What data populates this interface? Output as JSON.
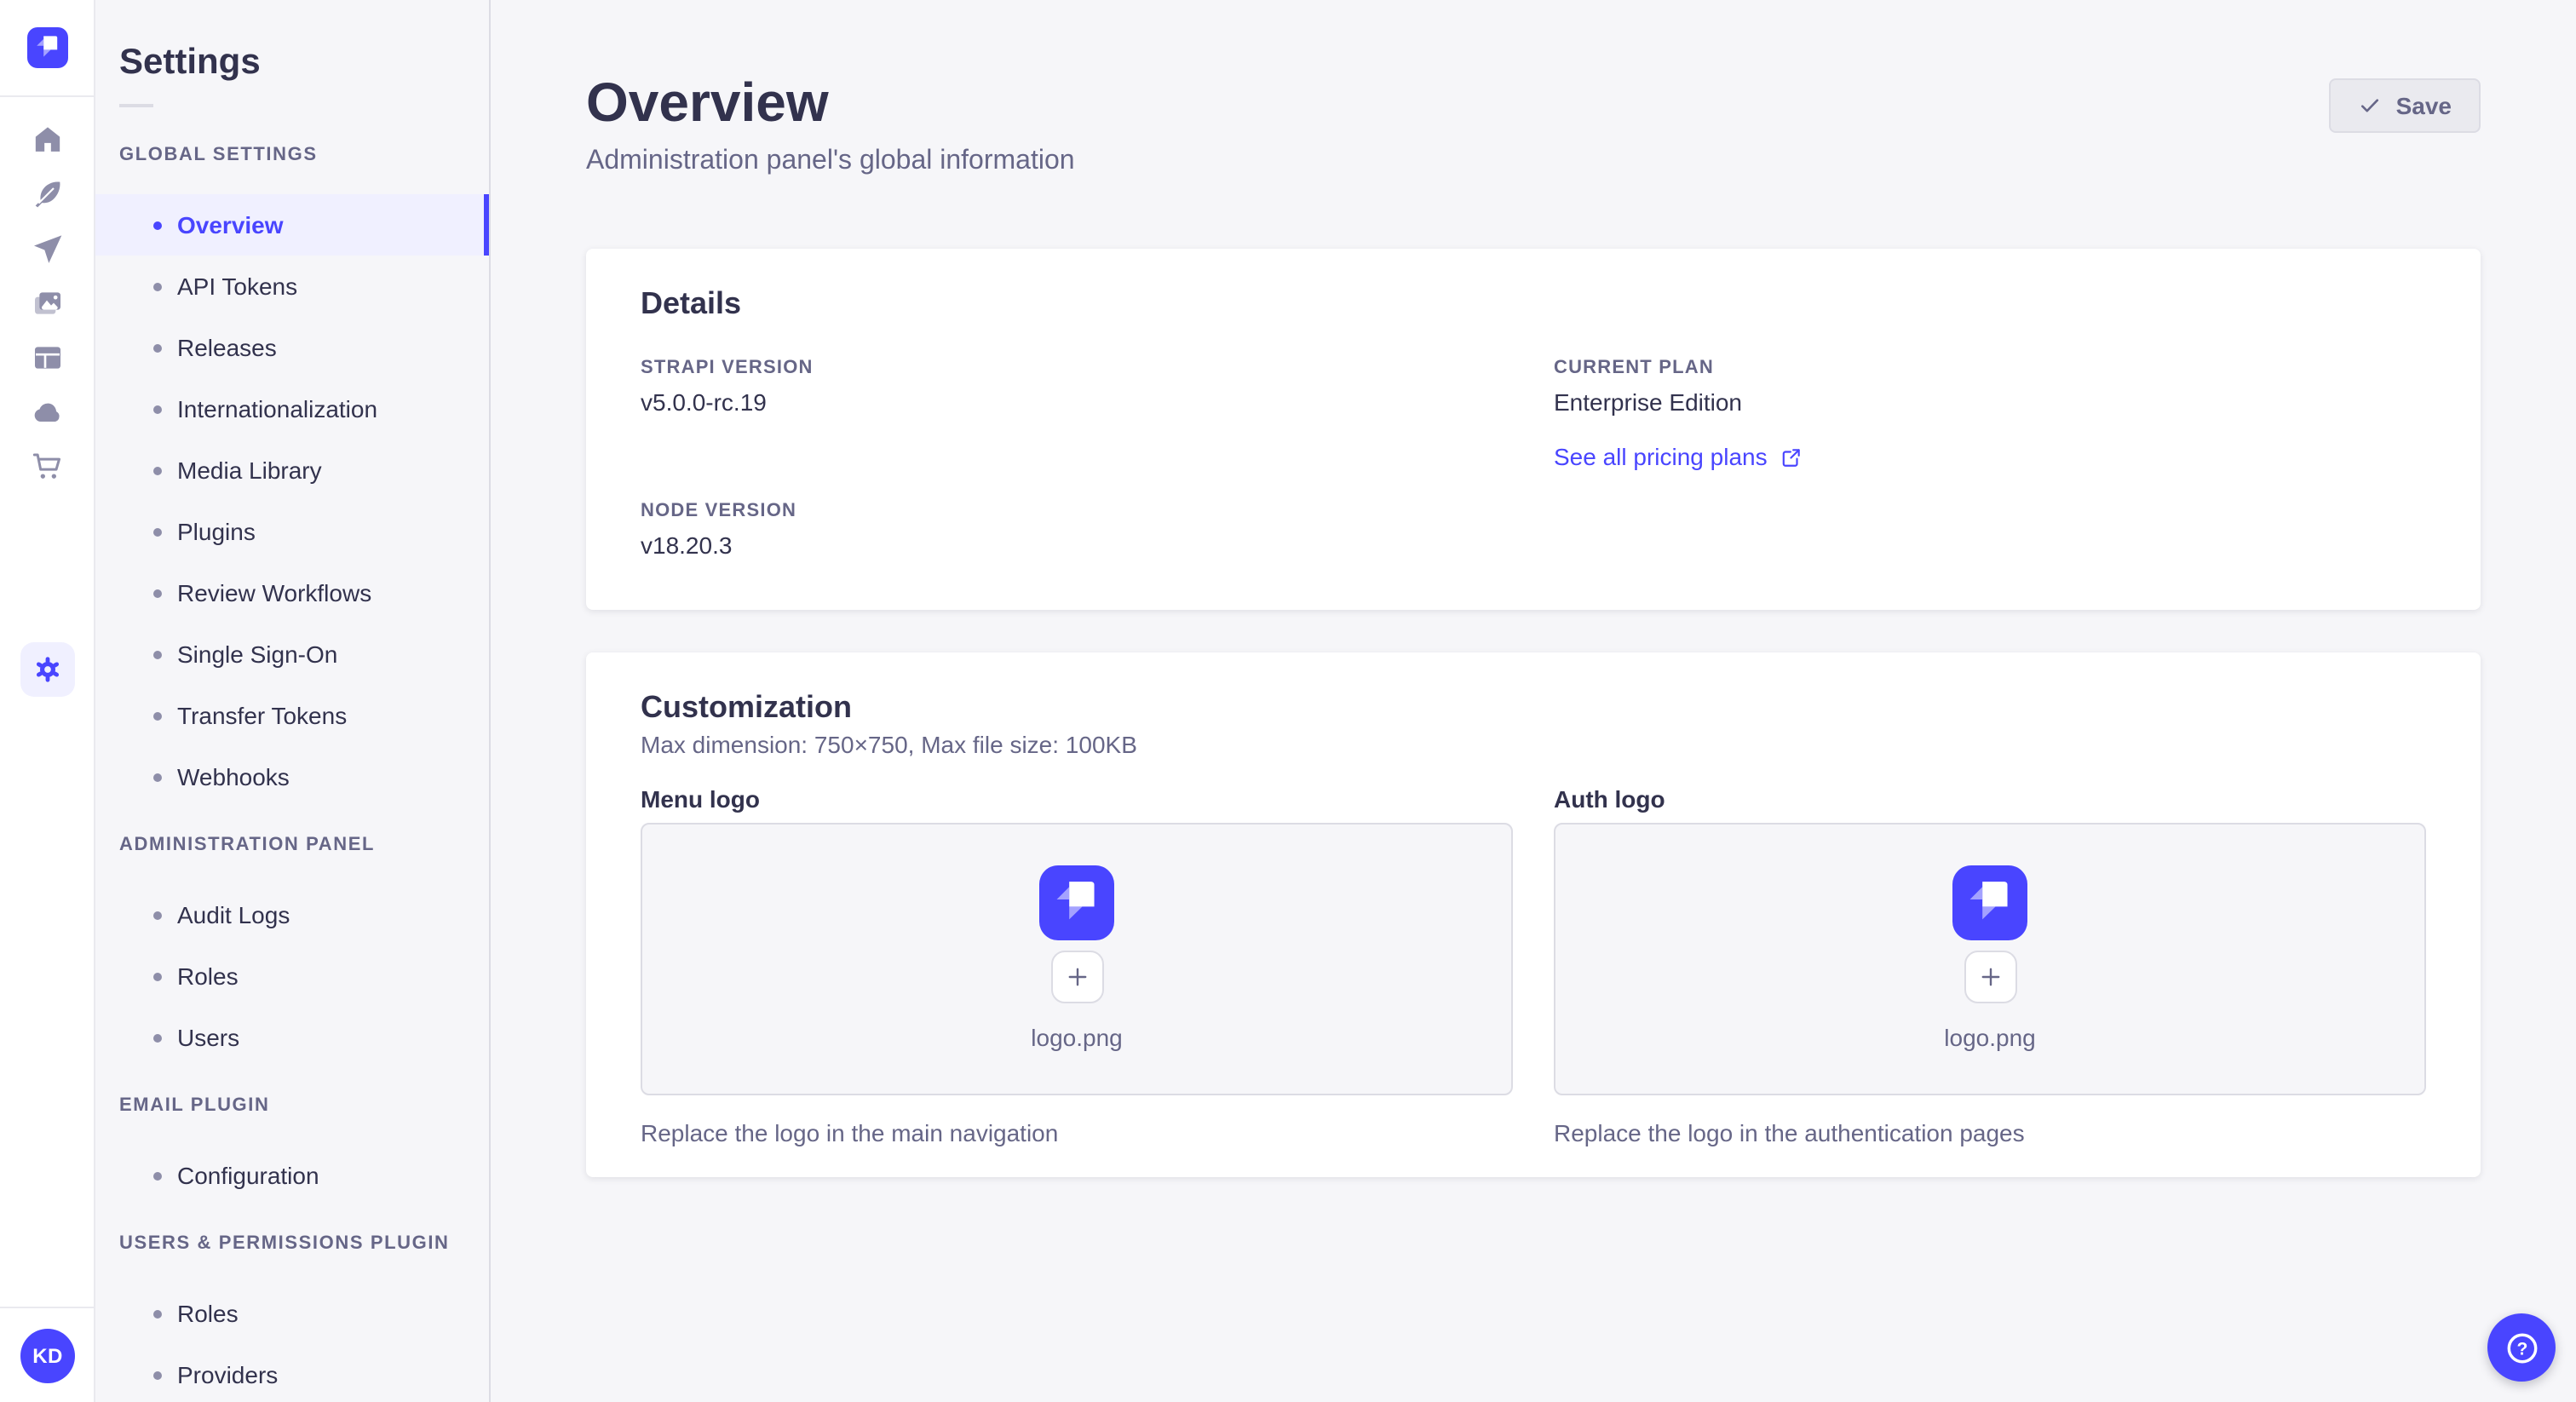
{
  "app": {
    "brand_color": "#4945ff",
    "active_bg": "#f0f0ff",
    "page_bg": "#f6f6f9"
  },
  "icon_rail": {
    "logo_icon": "strapi-logo",
    "items": [
      {
        "name": "home-icon"
      },
      {
        "name": "feather-icon"
      },
      {
        "name": "paper-plane-icon"
      },
      {
        "name": "pictures-icon"
      },
      {
        "name": "layout-icon"
      },
      {
        "name": "cloud-icon"
      },
      {
        "name": "cart-icon"
      }
    ],
    "settings_icon": "gear-icon",
    "avatar_initials": "KD",
    "help_glyph": "?"
  },
  "settings_nav": {
    "title": "Settings",
    "sections": [
      {
        "label": "GLOBAL SETTINGS",
        "items": [
          {
            "label": "Overview",
            "active": true
          },
          {
            "label": "API Tokens"
          },
          {
            "label": "Releases"
          },
          {
            "label": "Internationalization"
          },
          {
            "label": "Media Library"
          },
          {
            "label": "Plugins"
          },
          {
            "label": "Review Workflows"
          },
          {
            "label": "Single Sign-On"
          },
          {
            "label": "Transfer Tokens"
          },
          {
            "label": "Webhooks"
          }
        ]
      },
      {
        "label": "ADMINISTRATION PANEL",
        "items": [
          {
            "label": "Audit Logs"
          },
          {
            "label": "Roles"
          },
          {
            "label": "Users"
          }
        ]
      },
      {
        "label": "EMAIL PLUGIN",
        "items": [
          {
            "label": "Configuration"
          }
        ]
      },
      {
        "label": "USERS & PERMISSIONS PLUGIN",
        "items": [
          {
            "label": "Roles"
          },
          {
            "label": "Providers"
          }
        ]
      }
    ]
  },
  "header": {
    "title": "Overview",
    "subtitle": "Administration panel's global information",
    "save_label": "Save"
  },
  "details_card": {
    "title": "Details",
    "strapi_version_label": "STRAPI VERSION",
    "strapi_version": "v5.0.0-rc.19",
    "node_version_label": "NODE VERSION",
    "node_version": "v18.20.3",
    "current_plan_label": "CURRENT PLAN",
    "current_plan": "Enterprise Edition",
    "pricing_link": "See all pricing plans"
  },
  "customization_card": {
    "title": "Customization",
    "subtitle": "Max dimension: 750×750, Max file size: 100KB",
    "menu_logo": {
      "label": "Menu logo",
      "filename": "logo.png",
      "caption": "Replace the logo in the main navigation"
    },
    "auth_logo": {
      "label": "Auth logo",
      "filename": "logo.png",
      "caption": "Replace the logo in the authentication pages"
    }
  }
}
